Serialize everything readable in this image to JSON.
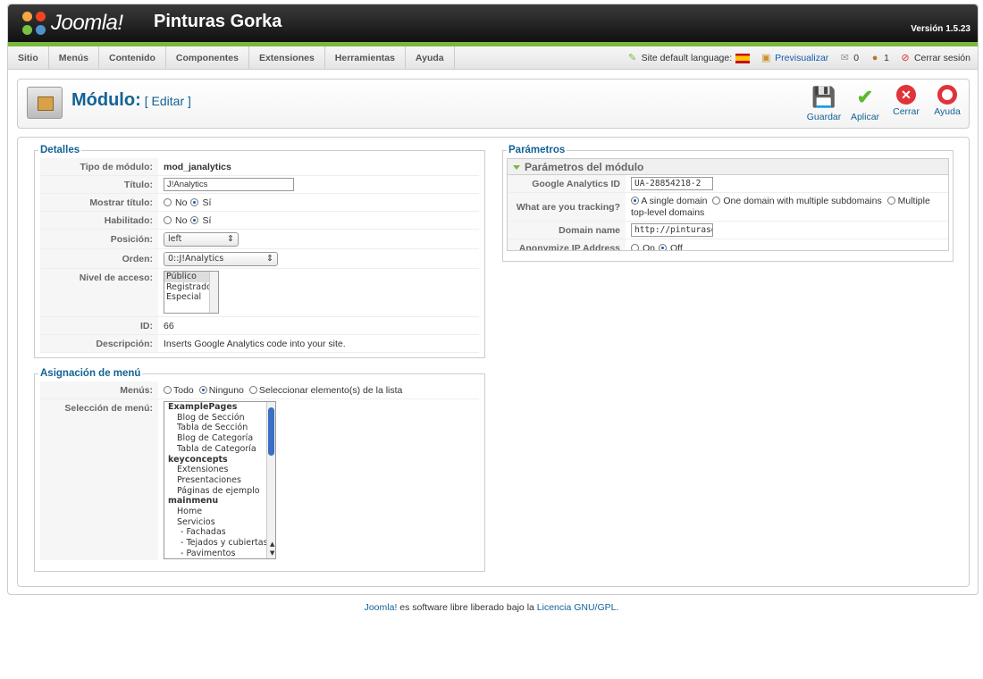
{
  "header": {
    "logo_text": "Joomla!",
    "site_name": "Pinturas Gorka",
    "version": "Versión 1.5.23"
  },
  "menubar": {
    "items": [
      "Sitio",
      "Menús",
      "Contenido",
      "Componentes",
      "Extensiones",
      "Herramientas",
      "Ayuda"
    ]
  },
  "status": {
    "language_label": "Site default language:",
    "preview": "Previsualizar",
    "messages": "0",
    "users": "1",
    "logout": "Cerrar sesión"
  },
  "toolbar": {
    "title": "Módulo:",
    "subtitle": "[ Editar ]",
    "buttons": [
      "Guardar",
      "Aplicar",
      "Cerrar",
      "Ayuda"
    ]
  },
  "details": {
    "legend": "Detalles",
    "labels": {
      "type": "Tipo de módulo:",
      "title": "Título:",
      "show_title": "Mostrar título:",
      "enabled": "Habilitado:",
      "position": "Posición:",
      "order": "Orden:",
      "access": "Nivel de acceso:",
      "id": "ID:",
      "description": "Descripción:"
    },
    "values": {
      "type": "mod_janalytics",
      "title": "J!Analytics",
      "no": "No",
      "yes": "Sí",
      "position": "left",
      "order": "0::J!Analytics",
      "id": "66",
      "description": "Inserts Google Analytics code into your site."
    },
    "access_options": [
      "Público",
      "Registrado",
      "Especial"
    ]
  },
  "menu_assign": {
    "legend": "Asignación de menú",
    "menus_label": "Menús:",
    "options": [
      "Todo",
      "Ninguno",
      "Seleccionar elemento(s) de la lista"
    ],
    "selection_label": "Selección de menú:",
    "items": [
      {
        "text": "ExamplePages",
        "bold": true
      },
      {
        "text": "Blog de Sección",
        "bold": false
      },
      {
        "text": "Tabla de Sección",
        "bold": false
      },
      {
        "text": "Blog de Categoría",
        "bold": false
      },
      {
        "text": "Tabla de Categoría",
        "bold": false
      },
      {
        "text": "keyconcepts",
        "bold": true
      },
      {
        "text": "Extensiones",
        "bold": false
      },
      {
        "text": "Presentaciones",
        "bold": false
      },
      {
        "text": "Páginas de ejemplo",
        "bold": false
      },
      {
        "text": "mainmenu",
        "bold": true
      },
      {
        "text": "Home",
        "bold": false
      },
      {
        "text": "Servicios",
        "bold": false
      },
      {
        "text": "- Fachadas",
        "bold": false
      },
      {
        "text": "- Tejados y cubiertas",
        "bold": false
      },
      {
        "text": "- Pavimentos",
        "bold": false
      }
    ]
  },
  "params": {
    "legend": "Parámetros",
    "panel_title": "Parámetros del módulo",
    "ga_label": "Google Analytics ID",
    "ga_value": "UA-28854218-2",
    "tracking_label": "What are you tracking?",
    "tracking_options": [
      "A single domain",
      "One domain with multiple subdomains",
      "Multiple top-level domains"
    ],
    "domain_label": "Domain name",
    "domain_value": "http://pinturasgork",
    "anon_label": "Anonymize IP Address",
    "on": "On",
    "off": "Off"
  },
  "footer": {
    "prefix": "Joomla!",
    "middle": " es software libre liberado bajo la ",
    "license": "Licencia GNU/GPL",
    "suffix": "."
  }
}
